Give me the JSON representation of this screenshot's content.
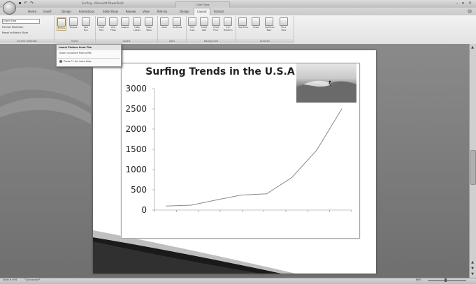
{
  "titlebar": {
    "window_title": "Surfing - Microsoft PowerPoint",
    "context_tab": "Chart Tools"
  },
  "tabs": [
    "Home",
    "Insert",
    "Design",
    "Animations",
    "Slide Show",
    "Review",
    "View",
    "Add-Ins",
    "Design",
    "Layout",
    "Format"
  ],
  "active_tab": "Layout",
  "ribbon": {
    "current_selection": {
      "element": "Chart Area",
      "format_selection": "Format Selection",
      "reset": "Reset to Match Style",
      "group_label": "Current Selection"
    },
    "insert_group": {
      "label": "Insert",
      "buttons": [
        "Picture",
        "Shapes",
        "Text Box"
      ]
    },
    "labels_group": {
      "label": "Labels",
      "buttons": [
        "Chart Title",
        "Axis Titles",
        "Legend",
        "Data Labels",
        "Data Table"
      ]
    },
    "axes_group": {
      "label": "Axes",
      "buttons": [
        "Axes",
        "Gridlines"
      ]
    },
    "background_group": {
      "label": "Background",
      "buttons": [
        "Plot Area",
        "Chart Wall",
        "Chart Floor",
        "3-D Rotation"
      ]
    },
    "analysis_group": {
      "label": "Analysis",
      "buttons": [
        "Trendline",
        "Lines",
        "Up/Down Bars",
        "Error Bars"
      ]
    }
  },
  "dropdown": {
    "heading": "Insert Picture from File",
    "description": "Insert a picture from a file.",
    "help": "Press F1 for more help."
  },
  "chart_data": {
    "type": "line",
    "title": "Surfing Trends in the U.S.A",
    "xlabel": "",
    "ylabel": "",
    "ylim": [
      0,
      3000
    ],
    "yticks": [
      "0",
      "500",
      "1000",
      "1500",
      "2000",
      "2500",
      "3000"
    ],
    "grid": false,
    "legend": "none",
    "series": [
      {
        "values": [
          100,
          120,
          250,
          370,
          400,
          800,
          1480,
          2500
        ]
      }
    ],
    "line_color": "#8a8a8a"
  },
  "statusbar": {
    "slide": "Slide 6 of 6",
    "theme": "\"Concourse\"",
    "zoom": "68%"
  }
}
